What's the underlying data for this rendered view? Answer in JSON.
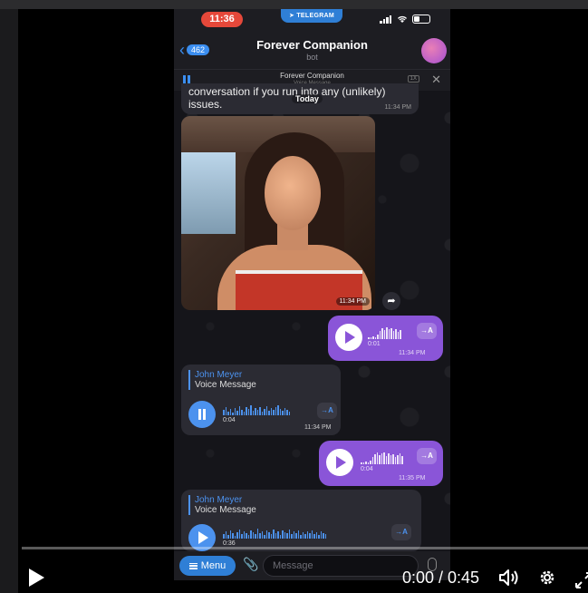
{
  "status_bar": {
    "time": "11:36",
    "telegram_label": "TELEGRAM"
  },
  "header": {
    "back_count": "462",
    "title": "Forever Companion",
    "subtitle": "bot"
  },
  "now_playing": {
    "title": "Forever Companion",
    "subtitle": "Voice Message",
    "speed": "1X"
  },
  "messages": {
    "previous_text": "conversation if you run into any (unlikely) issues.",
    "previous_time": "11:34 PM",
    "date_separator": "Today",
    "photo_time": "11:34 PM",
    "voice_out_1": {
      "duration": "0:01",
      "time": "11:34 PM",
      "translate": "→A"
    },
    "voice_in_1": {
      "reply_name": "John Meyer",
      "reply_sub": "Voice Message",
      "duration": "0:04",
      "time": "11:34 PM",
      "translate": "→A"
    },
    "voice_out_2": {
      "duration": "0:04",
      "time": "11:35 PM",
      "translate": "→A"
    },
    "voice_in_2": {
      "reply_name": "John Meyer",
      "reply_sub": "Voice Message",
      "duration": "0:36",
      "translate": "→A"
    }
  },
  "composer": {
    "menu_label": "Menu",
    "placeholder": "Message"
  },
  "video": {
    "timecode": "0:00 / 0:45",
    "progress": 0
  },
  "colors": {
    "accent": "#3b8ef0",
    "outgoing_bubble": "#8a55d8",
    "incoming_bubble": "#2b2b33",
    "clock_pill": "#e5483a"
  }
}
